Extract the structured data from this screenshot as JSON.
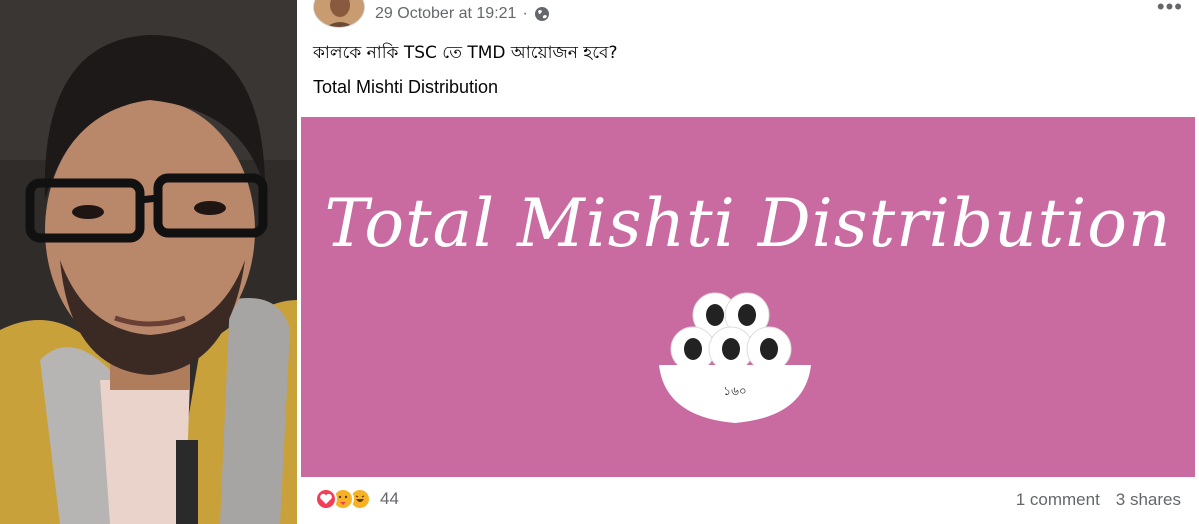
{
  "post": {
    "timestamp": "29 October at 19:21",
    "separator": "·",
    "privacy_icon": "globe-icon",
    "more_icon": "more-options-icon",
    "text_line1": "কালকে নাকি TSC তে TMD আয়োজন হবে?",
    "text_line2": "Total Mishti Distribution"
  },
  "banner": {
    "title": "Total Mishti Distribution",
    "bowl_label": "১৬০",
    "background_color": "#c96aa0"
  },
  "footer": {
    "reaction_icons": [
      "love-reaction-icon",
      "care-reaction-icon",
      "haha-reaction-icon"
    ],
    "reaction_count": "44",
    "comments": "1 comment",
    "shares": "3 shares"
  }
}
